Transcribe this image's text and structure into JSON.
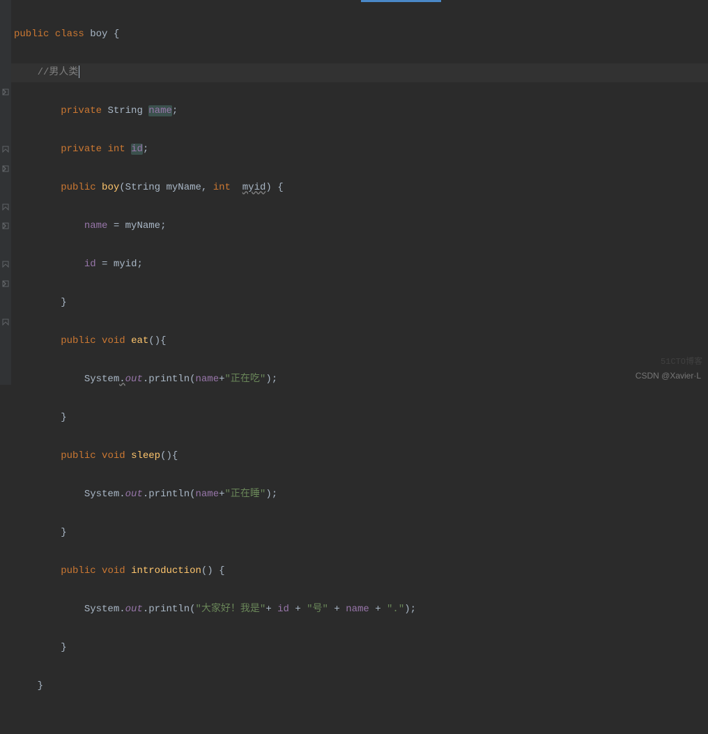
{
  "code": {
    "kw_public": "public",
    "kw_class": "class",
    "kw_private": "private",
    "kw_void": "void",
    "kw_int": "int",
    "cls_boy": "boy",
    "type_String": "String",
    "type_int": "int",
    "field_name": "name",
    "field_id": "id",
    "method_boy": "boy",
    "method_eat": "eat",
    "method_sleep": "sleep",
    "method_introduction": "introduction",
    "param_myName": "myName",
    "param_myid": "myid",
    "var_name": "name",
    "var_id": "id",
    "var_myName": "myName",
    "var_myid": "myid",
    "system": "System",
    "out": "out",
    "println": "println",
    "comment_boy": "//男人类",
    "str_eating": "\"正在吃\"",
    "str_sleeping": "\"正在睡\"",
    "str_hello": "\"大家好！我是\"",
    "str_hao": "\"号\"",
    "str_dot": "\".\"",
    "plus": "+",
    "lbrace": "{",
    "rbrace": "}",
    "lparen": "(",
    "rparen": ")",
    "semi": ";",
    "comma": ",",
    "eq": "=",
    "dot": "."
  },
  "watermark": {
    "right": "51CTO博客",
    "bottom": "CSDN @Xavier·L"
  }
}
